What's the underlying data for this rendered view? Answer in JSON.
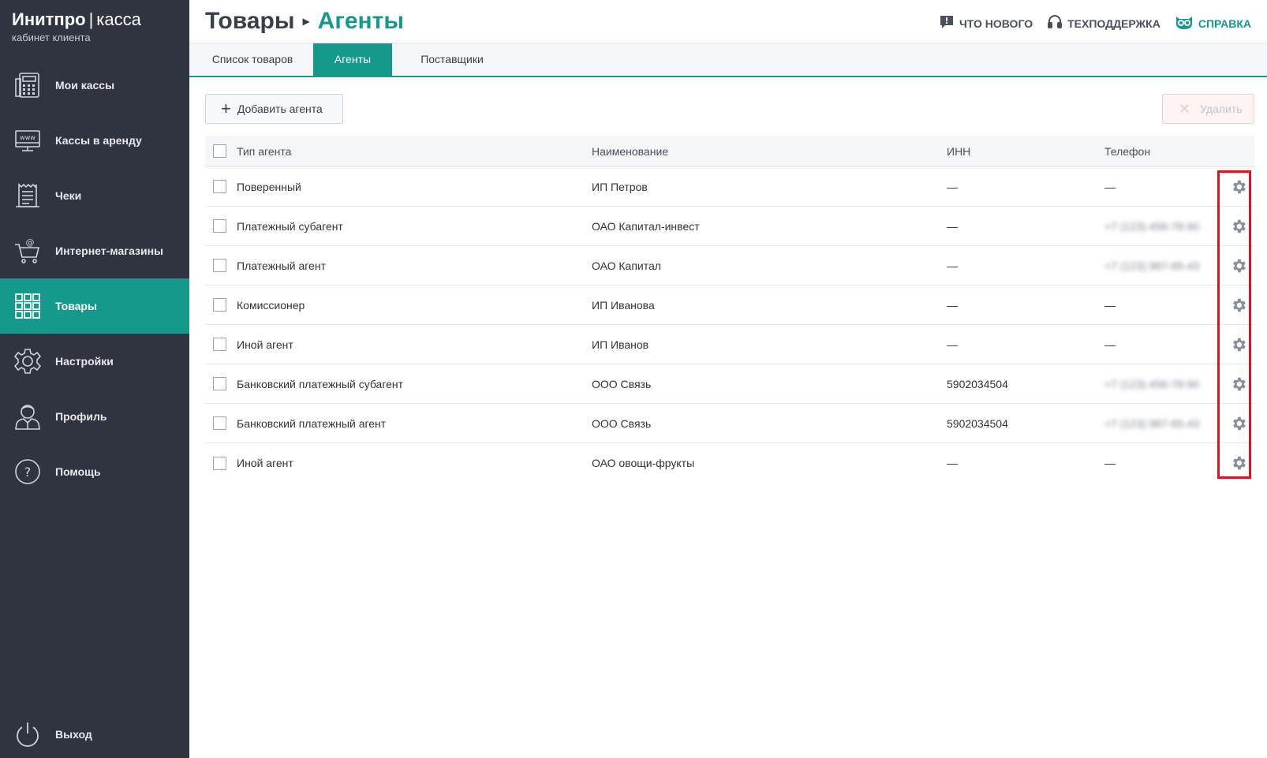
{
  "brand": {
    "name": "Инитпро",
    "separator": "|",
    "product": "касса",
    "subtitle": "кабинет клиента"
  },
  "sidebar": {
    "items": [
      {
        "label": "Мои кассы",
        "icon": "cash-register-icon"
      },
      {
        "label": "Кассы в аренду",
        "icon": "www-monitor-icon"
      },
      {
        "label": "Чеки",
        "icon": "receipt-icon"
      },
      {
        "label": "Интернет-магазины",
        "icon": "shopping-cart-icon"
      },
      {
        "label": "Товары",
        "icon": "grid-icon",
        "active": true
      },
      {
        "label": "Настройки",
        "icon": "gear-icon"
      },
      {
        "label": "Профиль",
        "icon": "user-icon"
      },
      {
        "label": "Помощь",
        "icon": "help-icon"
      }
    ],
    "logout": {
      "label": "Выход",
      "icon": "power-icon"
    }
  },
  "header": {
    "breadcrumb": [
      "Товары",
      "Агенты"
    ],
    "links": [
      {
        "label": "ЧТО НОВОГО",
        "icon": "news-icon"
      },
      {
        "label": "ТЕХПОДДЕРЖКА",
        "icon": "headset-icon"
      },
      {
        "label": "СПРАВКА",
        "icon": "owl-icon"
      }
    ]
  },
  "tabs": [
    {
      "label": "Список товаров"
    },
    {
      "label": "Агенты",
      "active": true
    },
    {
      "label": "Поставщики"
    }
  ],
  "toolbar": {
    "add_label": "Добавить агента",
    "delete_label": "Удалить"
  },
  "table": {
    "columns": [
      "Тип агента",
      "Наименование",
      "ИНН",
      "Телефон"
    ],
    "rows": [
      {
        "type": "Поверенный",
        "name": "ИП Петров",
        "inn": "—",
        "phone": "—"
      },
      {
        "type": "Платежный субагент",
        "name": "ОАО Капитал-инвест",
        "inn": "—",
        "phone": "+7 (123) 456-78-90"
      },
      {
        "type": "Платежный агент",
        "name": "ОАО Капитал",
        "inn": "—",
        "phone": "+7 (123) 987-65-43"
      },
      {
        "type": "Комиссионер",
        "name": "ИП Иванова",
        "inn": "—",
        "phone": "—"
      },
      {
        "type": "Иной агент",
        "name": "ИП Иванов",
        "inn": "—",
        "phone": "—"
      },
      {
        "type": "Банковский платежный субагент",
        "name": "ООО Связь",
        "inn": "5902034504",
        "phone": "+7 (123) 456-78-90"
      },
      {
        "type": "Банковский платежный агент",
        "name": "ООО Связь",
        "inn": "5902034504",
        "phone": "+7 (123) 987-65-43"
      },
      {
        "type": "Иной агент",
        "name": "ОАО овощи-фрукты",
        "inn": "—",
        "phone": "—"
      }
    ]
  },
  "colors": {
    "accent": "#14998b",
    "sidebar_bg": "#2f3440",
    "highlight": "#e3111a"
  }
}
